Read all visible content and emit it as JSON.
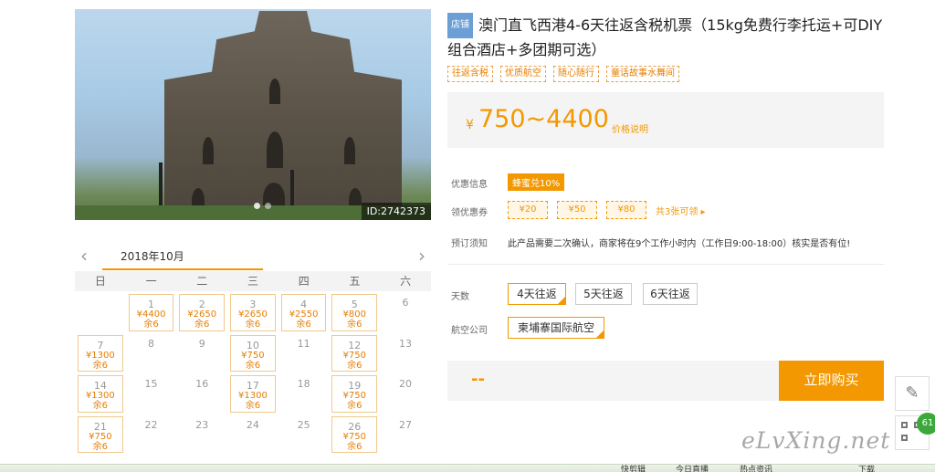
{
  "photo": {
    "id_tag": "ID:2742373"
  },
  "calendar": {
    "month": "2018年10月",
    "weekdays": [
      "日",
      "一",
      "二",
      "三",
      "四",
      "五",
      "六"
    ],
    "cells": [
      {
        "day": "",
        "price": "",
        "stock": ""
      },
      {
        "day": "1",
        "price": "¥4400",
        "stock": "余6"
      },
      {
        "day": "2",
        "price": "¥2650",
        "stock": "余6"
      },
      {
        "day": "3",
        "price": "¥2650",
        "stock": "余6"
      },
      {
        "day": "4",
        "price": "¥2550",
        "stock": "余6"
      },
      {
        "day": "5",
        "price": "¥800",
        "stock": "余6"
      },
      {
        "day": "6",
        "price": "",
        "stock": ""
      },
      {
        "day": "7",
        "price": "¥1300",
        "stock": "余6"
      },
      {
        "day": "8",
        "price": "",
        "stock": ""
      },
      {
        "day": "9",
        "price": "",
        "stock": ""
      },
      {
        "day": "10",
        "price": "¥750",
        "stock": "余6"
      },
      {
        "day": "11",
        "price": "",
        "stock": ""
      },
      {
        "day": "12",
        "price": "¥750",
        "stock": "余6"
      },
      {
        "day": "13",
        "price": "",
        "stock": ""
      },
      {
        "day": "14",
        "price": "¥1300",
        "stock": "余6"
      },
      {
        "day": "15",
        "price": "",
        "stock": ""
      },
      {
        "day": "16",
        "price": "",
        "stock": ""
      },
      {
        "day": "17",
        "price": "¥1300",
        "stock": "余6"
      },
      {
        "day": "18",
        "price": "",
        "stock": ""
      },
      {
        "day": "19",
        "price": "¥750",
        "stock": "余6"
      },
      {
        "day": "20",
        "price": "",
        "stock": ""
      },
      {
        "day": "21",
        "price": "¥750",
        "stock": "余6"
      },
      {
        "day": "22",
        "price": "",
        "stock": ""
      },
      {
        "day": "23",
        "price": "",
        "stock": ""
      },
      {
        "day": "24",
        "price": "",
        "stock": ""
      },
      {
        "day": "25",
        "price": "",
        "stock": ""
      },
      {
        "day": "26",
        "price": "¥750",
        "stock": "余6"
      },
      {
        "day": "27",
        "price": "",
        "stock": ""
      }
    ]
  },
  "product": {
    "shop_badge": "店铺",
    "title": "澳门直飞西港4-6天往返含税机票（15kg免费行李托运+可DIY组合酒店+多团期可选）",
    "tags": [
      "往返含税",
      "优质航空",
      "随心随行",
      "童话故事水舞间"
    ],
    "currency": "¥",
    "price": "750~4400",
    "price_explain": "价格说明"
  },
  "promo": {
    "label": "优惠信息",
    "badge": "蜂蜜兑10%"
  },
  "coupons": {
    "label": "领优惠券",
    "items": [
      "¥20",
      "¥50",
      "¥80"
    ],
    "more": "共3张可领 ▸"
  },
  "notice": {
    "label": "预订须知",
    "text": "此产品需要二次确认，商家将在9个工作小时内（工作日9:00-18:00）核实是否有位!"
  },
  "days": {
    "label": "天数",
    "options": [
      "4天往返",
      "5天往返",
      "6天往返"
    ]
  },
  "airline": {
    "label": "航空公司",
    "options": [
      "柬埔寨国际航空"
    ]
  },
  "buy": {
    "total": "--",
    "button": "立即购买"
  },
  "side": {
    "badge": "61"
  },
  "watermark": "eLvXing.net",
  "taskbar": [
    "快剪辑",
    "今日直播",
    "热点资讯",
    "下载"
  ],
  "colors": {
    "accent": "#f39800",
    "shop_badge": "#6b9fd6"
  }
}
